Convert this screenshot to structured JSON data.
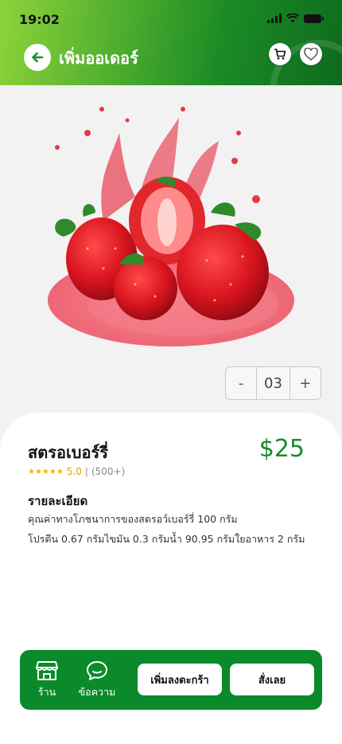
{
  "status_bar": {
    "time": "19:02"
  },
  "header": {
    "title": "เพิ่มออเดอร์"
  },
  "quantity": {
    "minus": "-",
    "value": "03",
    "plus": "+"
  },
  "product": {
    "name": "สตรอเบอร์รี่",
    "price": "$25",
    "rating": "5.0",
    "rating_count": "(500+)",
    "stars": "★★★★★"
  },
  "details": {
    "title": "รายละเอียด",
    "line1": "คุณค่าทางโภชนาการของสตรอว์เบอร์รี่ 100 กรัม",
    "line2": "โปรตีน 0.67 กรัมไขมัน 0.3 กรัมน้ำ 90.95 กรัมใยอาหาร 2 กรัม"
  },
  "bottom_bar": {
    "shop_label": "ร้าน",
    "message_label": "ข้อความ",
    "add_to_cart": "เพิ่มลงตะกร้า",
    "buy_now": "สั่งเลย"
  },
  "colors": {
    "brand_green": "#0a8a2a",
    "price_green": "#1a8a2f",
    "star": "#f0b400"
  }
}
